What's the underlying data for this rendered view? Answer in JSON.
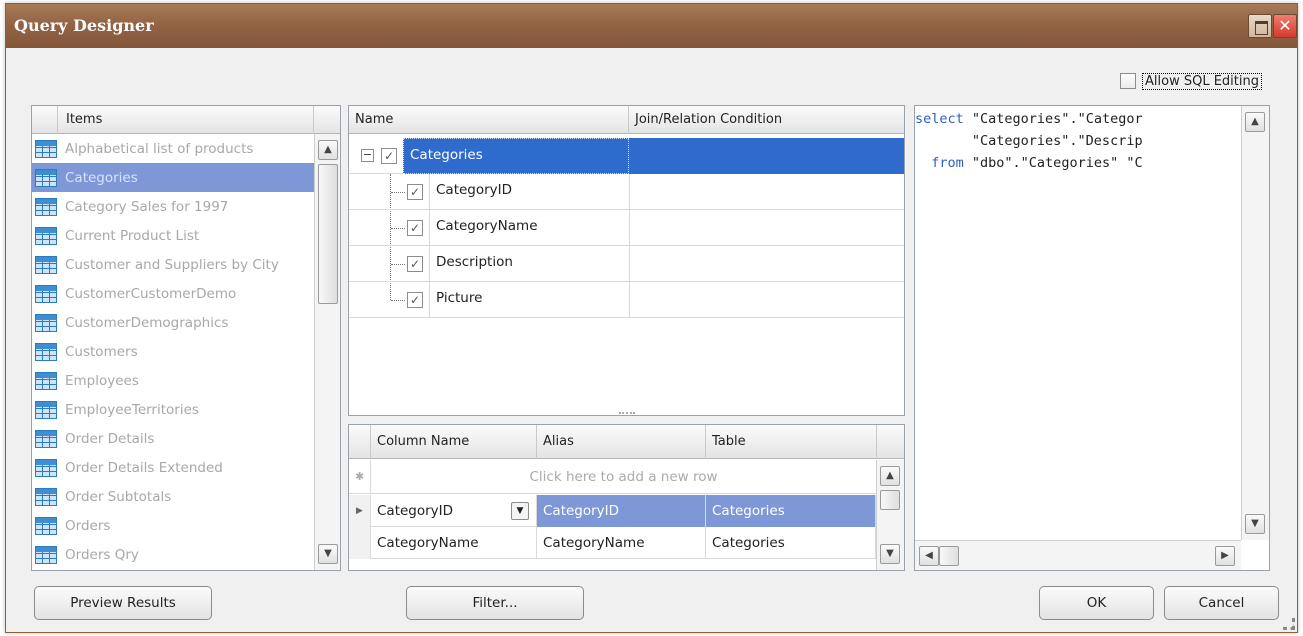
{
  "window": {
    "title": "Query Designer"
  },
  "options": {
    "allow_sql_editing_label": "Allow SQL Editing",
    "allow_sql_editing_checked": false
  },
  "items_panel": {
    "header": "Items",
    "items": [
      {
        "label": "Alphabetical list of products",
        "selected": false
      },
      {
        "label": "Categories",
        "selected": true
      },
      {
        "label": "Category Sales for 1997",
        "selected": false
      },
      {
        "label": "Current Product List",
        "selected": false
      },
      {
        "label": "Customer and Suppliers by City",
        "selected": false
      },
      {
        "label": "CustomerCustomerDemo",
        "selected": false
      },
      {
        "label": "CustomerDemographics",
        "selected": false
      },
      {
        "label": "Customers",
        "selected": false
      },
      {
        "label": "Employees",
        "selected": false
      },
      {
        "label": "EmployeeTerritories",
        "selected": false
      },
      {
        "label": "Order Details",
        "selected": false
      },
      {
        "label": "Order Details Extended",
        "selected": false
      },
      {
        "label": "Order Subtotals",
        "selected": false
      },
      {
        "label": "Orders",
        "selected": false
      },
      {
        "label": "Orders Qry",
        "selected": false
      }
    ]
  },
  "relations": {
    "headers": {
      "name": "Name",
      "condition": "Join/Relation Condition"
    },
    "table": {
      "label": "Categories",
      "checked": true,
      "expanded": true
    },
    "columns": [
      {
        "label": "CategoryID",
        "checked": true
      },
      {
        "label": "CategoryName",
        "checked": true
      },
      {
        "label": "Description",
        "checked": true
      },
      {
        "label": "Picture",
        "checked": true
      }
    ]
  },
  "columns_grid": {
    "headers": {
      "column_name": "Column Name",
      "alias": "Alias",
      "table": "Table"
    },
    "new_row_text": "Click here to add a new row",
    "rows": [
      {
        "column_name": "CategoryID",
        "alias": "CategoryID",
        "table": "Categories",
        "selected": true
      },
      {
        "column_name": "CategoryName",
        "alias": "CategoryName",
        "table": "Categories",
        "selected": false
      }
    ]
  },
  "sql": {
    "lines": [
      {
        "kw": "select",
        "text": " \"Categories\".\"Categor"
      },
      {
        "kw": "",
        "text": "       \"Categories\".\"Descrip"
      },
      {
        "kw": "  from",
        "text": " \"dbo\".\"Categories\" \"C"
      }
    ]
  },
  "buttons": {
    "preview": "Preview Results",
    "filter": "Filter...",
    "ok": "OK",
    "cancel": "Cancel"
  }
}
